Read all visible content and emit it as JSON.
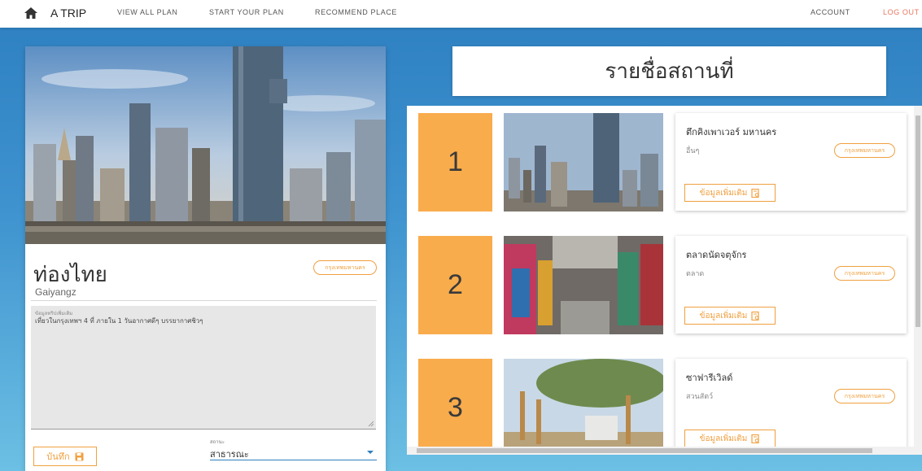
{
  "nav": {
    "brand": "A TRIP",
    "links": [
      "VIEW ALL PLAN",
      "START YOUR PLAN",
      "RECOMMEND PLACE"
    ],
    "account": "ACCOUNT",
    "logout": "LOG OUT"
  },
  "plan": {
    "title": "ท่องไทย",
    "province_badge": "กรุงเทพมหานคร",
    "author": "Gaiyangz",
    "detail_label": "ข้อมูลทริปเพิ่มเติม",
    "detail_text": "เที่ยวในกรุงเทพฯ 4 ที่ ภายใน 1 วันอากาศดีๆ บรรยากาศชิวๆ",
    "save_label": "บันทึก",
    "status_label": "สถานะ",
    "status_value": "สาธารณะ"
  },
  "list": {
    "title": "รายชื่อสถานที่",
    "more_label": "ข้อมูลเพิ่มเติม",
    "items": [
      {
        "num": "1",
        "name": "ตึกคิงเพาเวอร์ มหานคร",
        "category": "อื่นๆ",
        "province": "กรุงเทพมหานคร"
      },
      {
        "num": "2",
        "name": "ตลาดนัดจตุจักร",
        "category": "ตลาด",
        "province": "กรุงเทพมหานคร"
      },
      {
        "num": "3",
        "name": "ซาฟารีเวิลด์",
        "category": "สวนสัตว์",
        "province": "กรุงเทพมหานคร"
      }
    ]
  },
  "icons": {
    "home": "home-icon",
    "save": "floppy-disk-icon",
    "more": "document-search-icon",
    "select": "caret-down-icon"
  },
  "colors": {
    "accent": "#f0a040",
    "number_box": "#f8ac4c",
    "logout": "#e8765e",
    "background_top": "#2d7fc0",
    "background_bottom": "#6cc0e4"
  }
}
